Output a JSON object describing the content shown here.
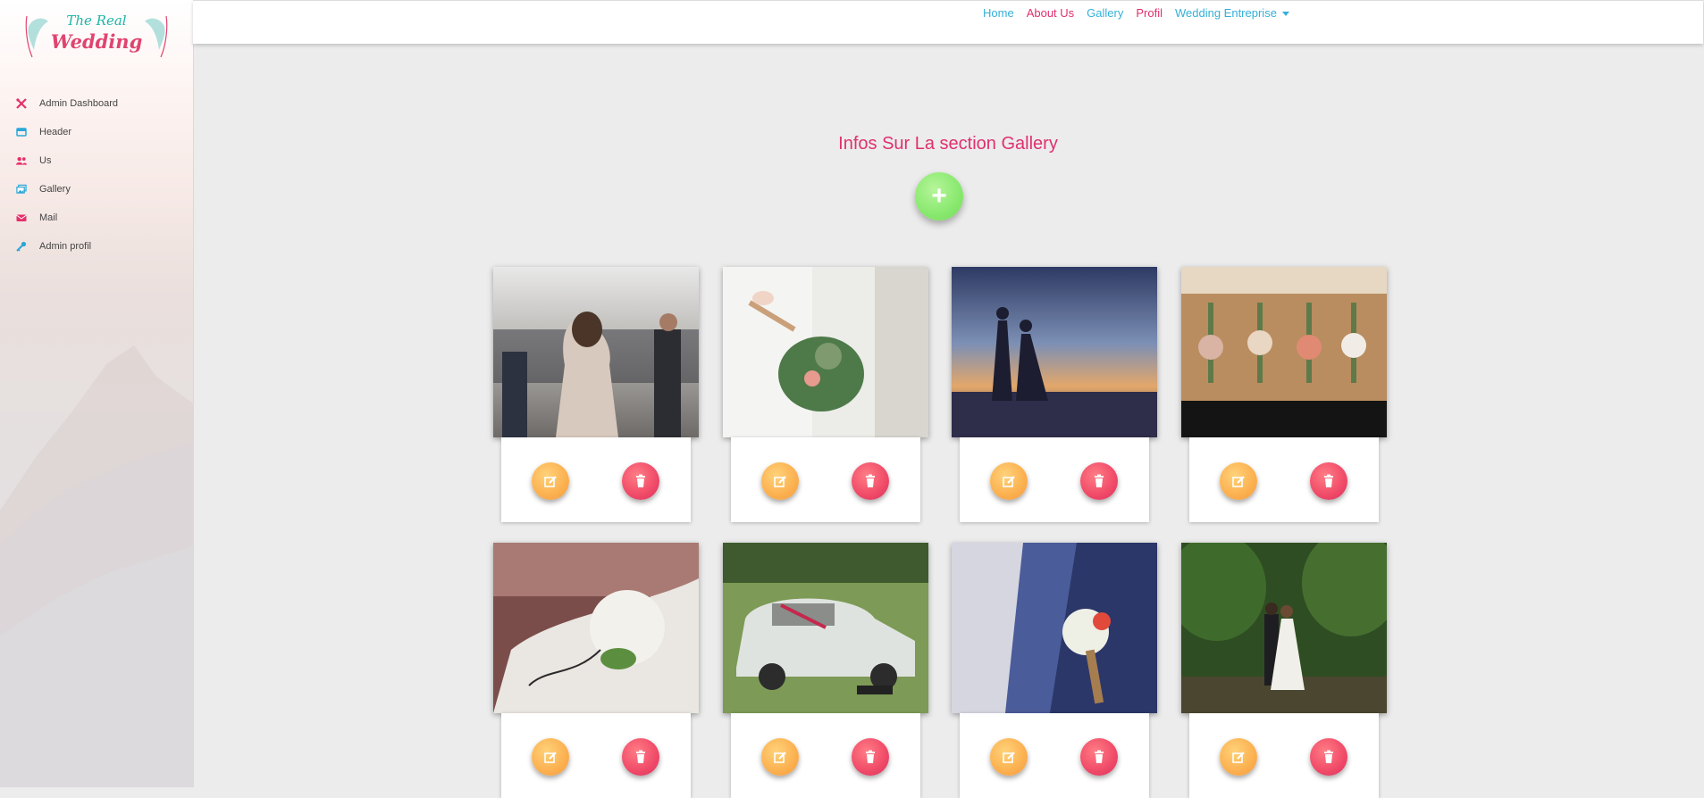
{
  "logo": {
    "line1": "The Real",
    "line2": "Wedding"
  },
  "sidebar": {
    "items": [
      {
        "label": "Admin Dashboard",
        "icon": "tools-icon",
        "color": "pink"
      },
      {
        "label": "Header",
        "icon": "window-icon",
        "color": "blue"
      },
      {
        "label": "Us",
        "icon": "users-icon",
        "color": "pink"
      },
      {
        "label": "Gallery",
        "icon": "images-icon",
        "color": "blue"
      },
      {
        "label": "Mail",
        "icon": "envelope-icon",
        "color": "pink"
      },
      {
        "label": "Admin profil",
        "icon": "key-icon",
        "color": "blue"
      }
    ]
  },
  "topnav": {
    "home": "Home",
    "about": "About Us",
    "gallery": "Gallery",
    "profil": "Profil",
    "entreprise": "Wedding Entreprise"
  },
  "main": {
    "title": "Infos Sur La section Gallery",
    "add_label": "+"
  },
  "gallery": [
    {
      "photo": "wedding-party-photo",
      "edit_icon": "edit-icon",
      "delete_icon": "trash-icon"
    },
    {
      "photo": "bridal-bouquet-photo",
      "edit_icon": "edit-icon",
      "delete_icon": "trash-icon"
    },
    {
      "photo": "couple-silhouette-photo",
      "edit_icon": "edit-icon",
      "delete_icon": "trash-icon"
    },
    {
      "photo": "boutonnieres-photo",
      "edit_icon": "edit-icon",
      "delete_icon": "trash-icon"
    },
    {
      "photo": "white-roses-bouquet-photo",
      "edit_icon": "edit-icon",
      "delete_icon": "trash-icon"
    },
    {
      "photo": "wedding-car-photo",
      "edit_icon": "edit-icon",
      "delete_icon": "trash-icon"
    },
    {
      "photo": "groom-boutonniere-photo",
      "edit_icon": "edit-icon",
      "delete_icon": "trash-icon"
    },
    {
      "photo": "couple-in-forest-photo",
      "edit_icon": "edit-icon",
      "delete_icon": "trash-icon"
    }
  ],
  "colors": {
    "accent_pink": "#e0306e",
    "accent_blue": "#35b0d9",
    "add_green": "#88e86e",
    "edit_orange": "#fbb04f",
    "delete_red": "#f04a68"
  }
}
